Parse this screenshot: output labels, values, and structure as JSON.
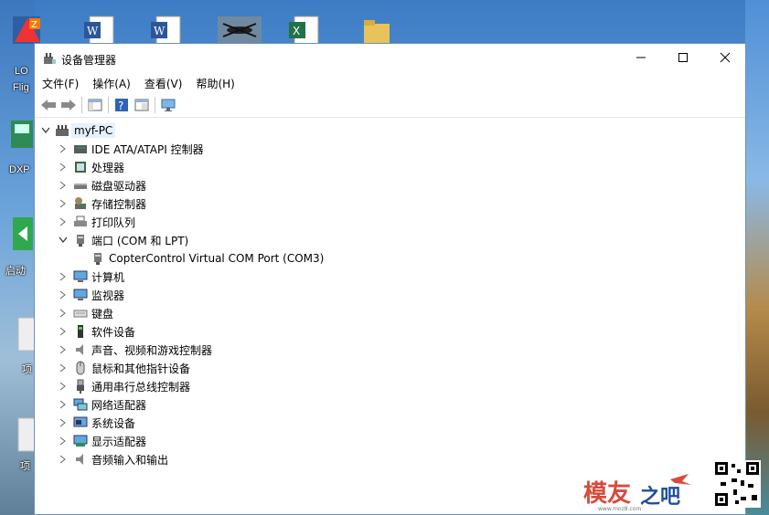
{
  "desktop": {
    "icons": [
      {
        "label": "LO",
        "name": "lo"
      },
      {
        "label": "Flig",
        "name": "flig"
      },
      {
        "label": "DXP",
        "name": "dxp"
      },
      {
        "label": "启动",
        "name": "start"
      },
      {
        "label": "项",
        "name": "project-1"
      },
      {
        "label": "项",
        "name": "project-2"
      }
    ]
  },
  "window": {
    "title": "设备管理器",
    "menu": [
      "文件(F)",
      "操作(A)",
      "查看(V)",
      "帮助(H)"
    ],
    "tree": {
      "root": "myf-PC",
      "items": [
        {
          "label": "IDE ATA/ATAPI 控制器",
          "icon": "ide-controller-icon"
        },
        {
          "label": "处理器",
          "icon": "processor-icon"
        },
        {
          "label": "磁盘驱动器",
          "icon": "disk-drive-icon"
        },
        {
          "label": "存储控制器",
          "icon": "storage-controller-icon"
        },
        {
          "label": "打印队列",
          "icon": "printer-icon"
        },
        {
          "label": "端口 (COM 和 LPT)",
          "icon": "port-icon",
          "expanded": true
        },
        {
          "label": "CopterControl Virtual COM Port (COM3)",
          "icon": "port-device-icon",
          "child": true
        },
        {
          "label": "计算机",
          "icon": "computer-icon"
        },
        {
          "label": "监视器",
          "icon": "monitor-icon"
        },
        {
          "label": "键盘",
          "icon": "keyboard-icon"
        },
        {
          "label": "软件设备",
          "icon": "software-device-icon"
        },
        {
          "label": "声音、视频和游戏控制器",
          "icon": "sound-icon"
        },
        {
          "label": "鼠标和其他指针设备",
          "icon": "mouse-icon"
        },
        {
          "label": "通用串行总线控制器",
          "icon": "usb-icon"
        },
        {
          "label": "网络适配器",
          "icon": "network-adapter-icon"
        },
        {
          "label": "系统设备",
          "icon": "system-device-icon"
        },
        {
          "label": "显示适配器",
          "icon": "display-adapter-icon"
        },
        {
          "label": "音频输入和输出",
          "icon": "audio-io-icon"
        }
      ]
    }
  },
  "watermark": {
    "text": "模友之吧",
    "url": "www.moz8.com"
  }
}
